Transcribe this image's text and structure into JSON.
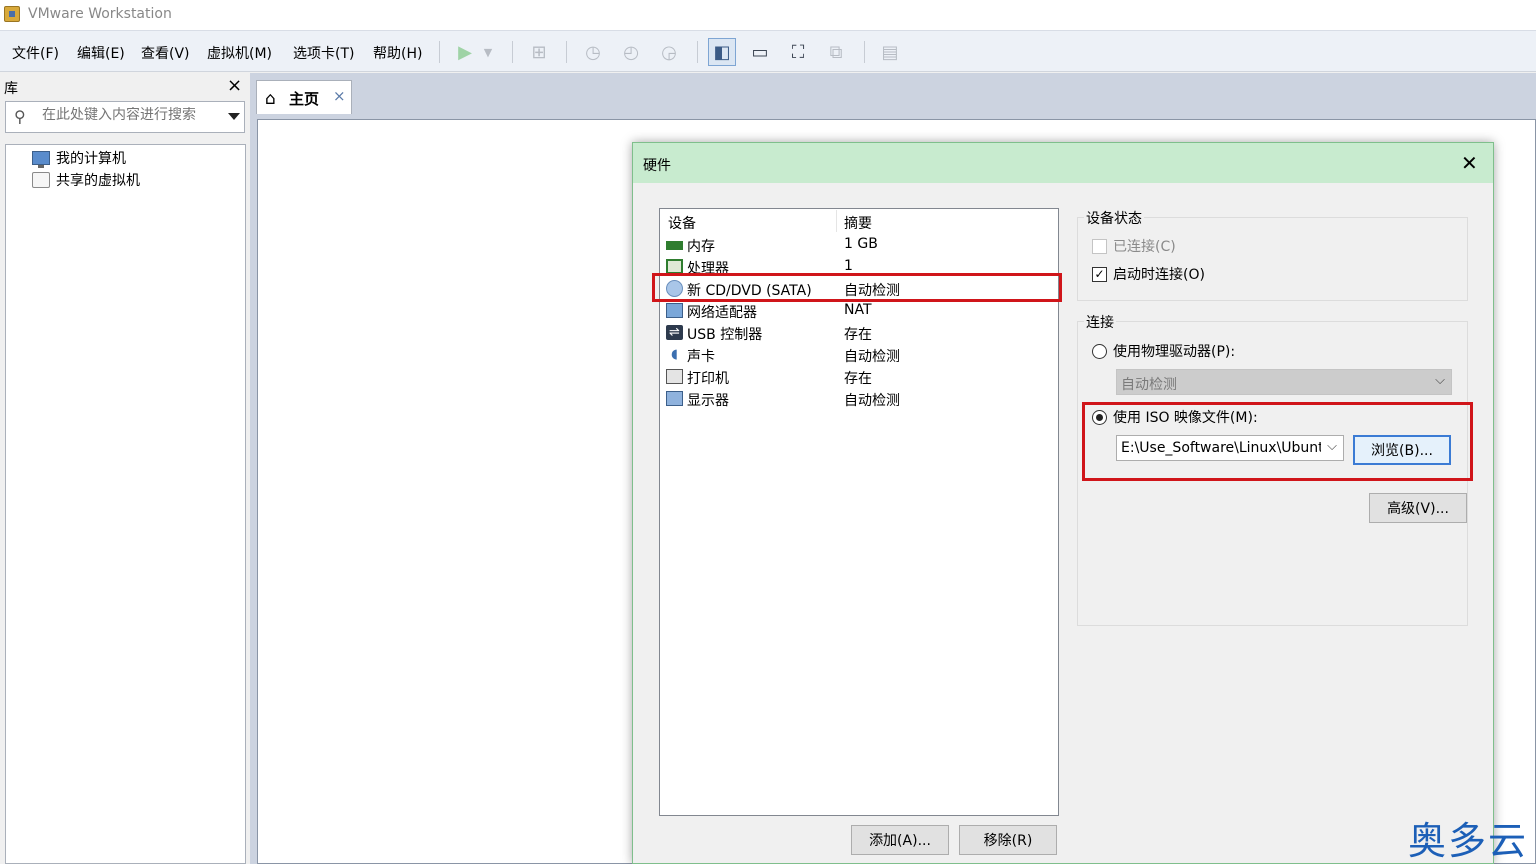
{
  "window": {
    "title": "VMware Workstation"
  },
  "menu": [
    "文件(F)",
    "编辑(E)",
    "查看(V)",
    "虚拟机(M)",
    "选项卡(T)",
    "帮助(H)"
  ],
  "library": {
    "title": "库",
    "close": "×",
    "search_placeholder": "在此处键入内容进行搜索",
    "items": [
      "我的计算机",
      "共享的虚拟机"
    ]
  },
  "tabs": [
    {
      "label": "主页",
      "close": "×"
    }
  ],
  "dialog": {
    "title": "硬件",
    "close": "✕",
    "columns": {
      "device": "设备",
      "summary": "摘要"
    },
    "devices": [
      {
        "icon": "memory-icon",
        "name": "内存",
        "summary": "1 GB"
      },
      {
        "icon": "processor-icon",
        "name": "处理器",
        "summary": "1"
      },
      {
        "icon": "cd-dvd-icon",
        "name": "新 CD/DVD (SATA)",
        "summary": "自动检测"
      },
      {
        "icon": "network-adapter-icon",
        "name": "网络适配器",
        "summary": "NAT"
      },
      {
        "icon": "usb-icon",
        "name": "USB 控制器",
        "summary": "存在"
      },
      {
        "icon": "sound-icon",
        "name": "声卡",
        "summary": "自动检测"
      },
      {
        "icon": "printer-icon",
        "name": "打印机",
        "summary": "存在"
      },
      {
        "icon": "display-icon",
        "name": "显示器",
        "summary": "自动检测"
      }
    ],
    "add_button": "添加(A)...",
    "remove_button": "移除(R)",
    "device_status": {
      "title": "设备状态",
      "connected": {
        "label": "已连接(C)",
        "checked": false,
        "enabled": false
      },
      "connect_at_power_on": {
        "label": "启动时连接(O)",
        "checked": true
      }
    },
    "connection": {
      "title": "连接",
      "physical_drive": {
        "label": "使用物理驱动器(P):",
        "selected": false,
        "value": "自动检测"
      },
      "iso_image": {
        "label": "使用 ISO 映像文件(M):",
        "selected": true,
        "value": "E:\\Use_Software\\Linux\\Ubuntu"
      },
      "browse_button": "浏览(B)..."
    },
    "advanced_button": "高级(V)..."
  },
  "watermark": "奥多云",
  "colors": {
    "highlight": "#d0151a",
    "dialog_title_bg": "#c8ebcf"
  }
}
